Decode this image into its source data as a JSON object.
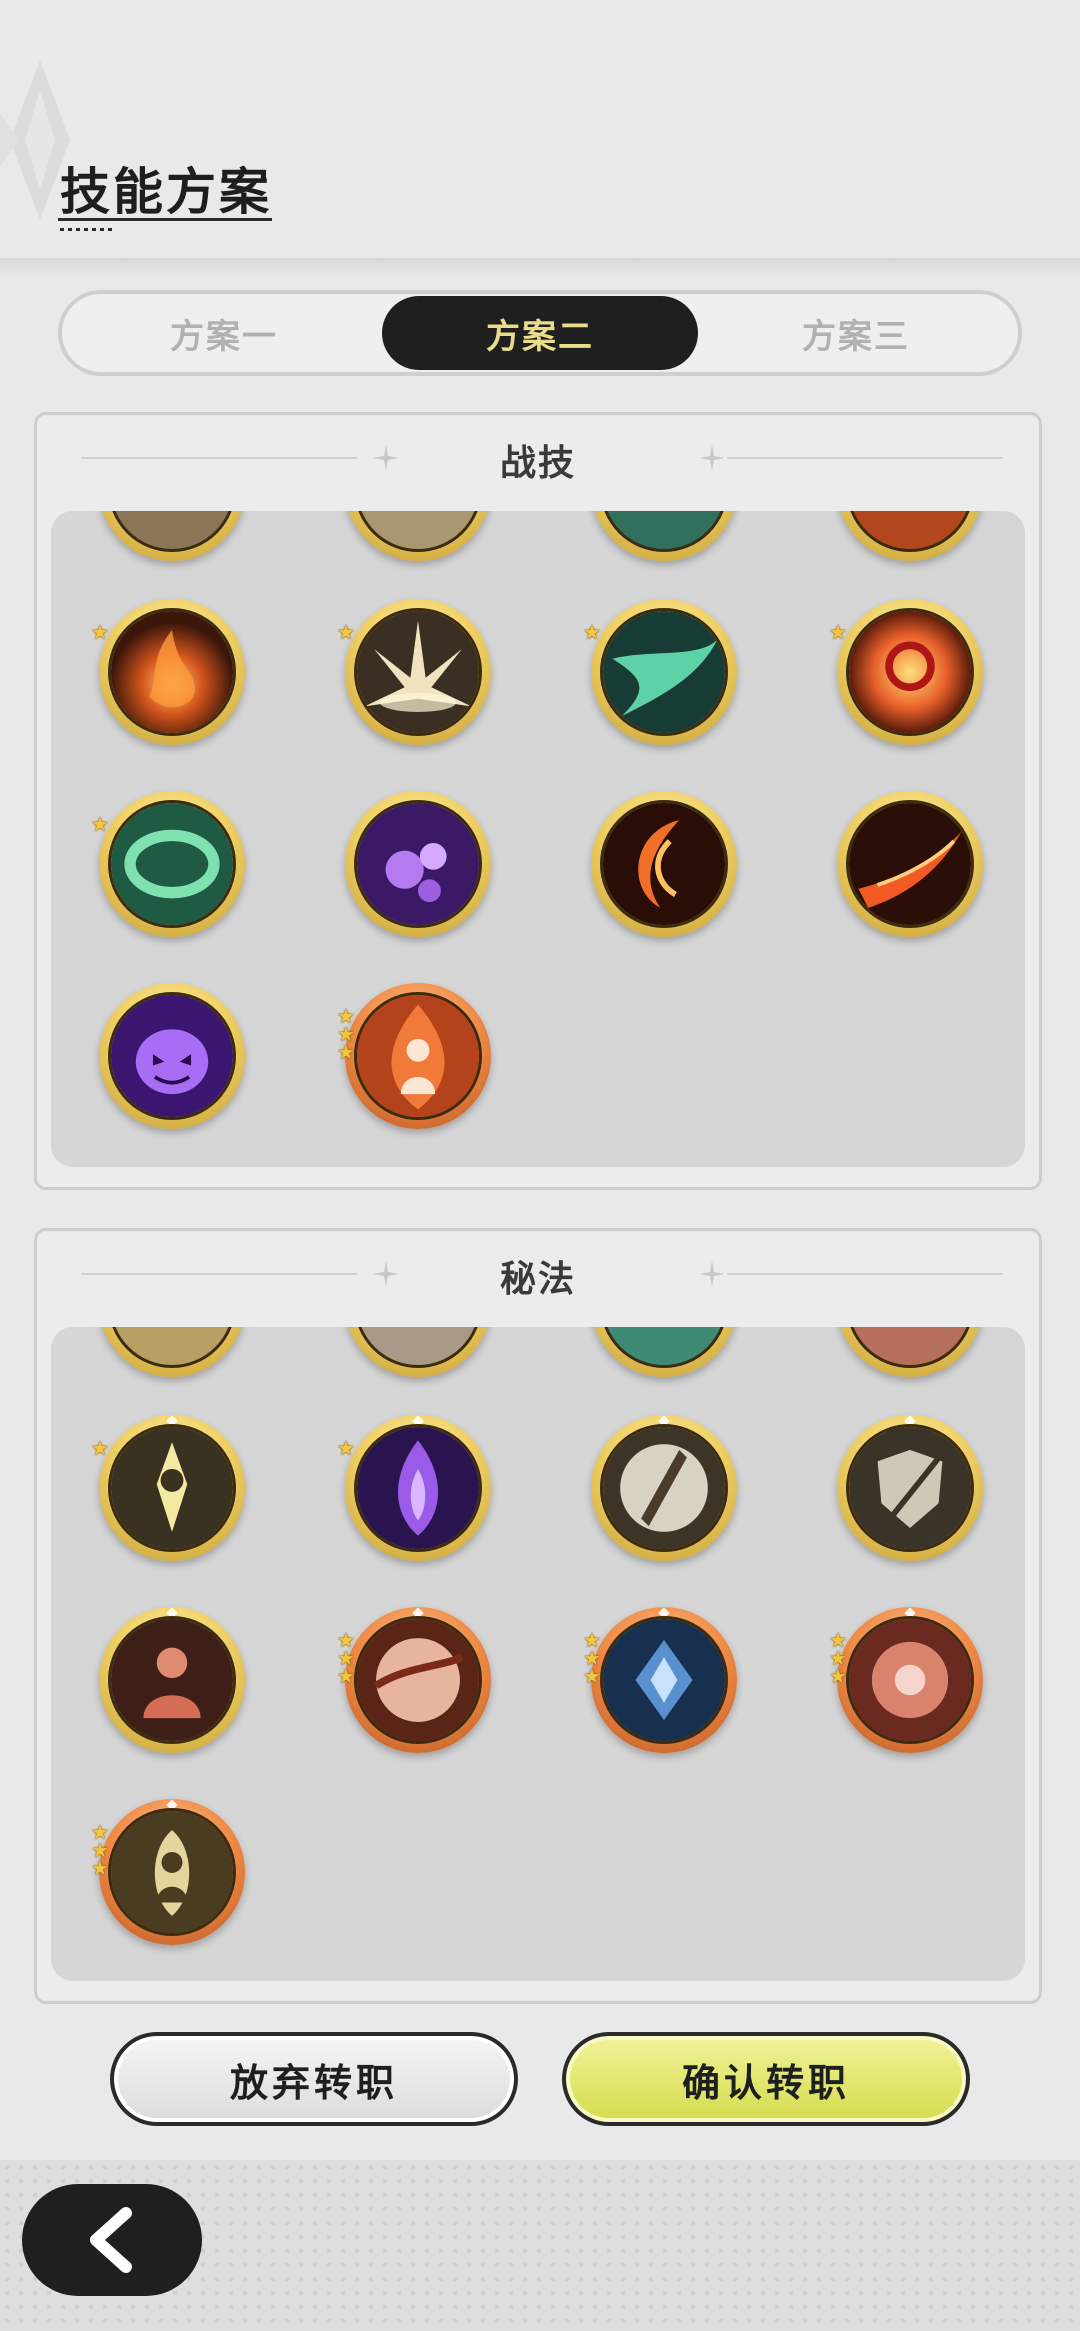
{
  "header": {
    "title": "技能方案"
  },
  "tabs": [
    {
      "label": "方案一",
      "active": false
    },
    {
      "label": "方案二",
      "active": true
    },
    {
      "label": "方案三",
      "active": false
    }
  ],
  "combat_panel": {
    "title": "战技",
    "icons": [
      "fire-swirl-icon",
      "light-burst-icon",
      "wind-slash-icon",
      "fire-seal-icon",
      "jade-ring-icon",
      "rose-purple-icon",
      "fire-crescent-icon",
      "fire-streak-icon",
      "shadow-spirit-icon",
      "flame-figure-icon"
    ]
  },
  "arcane_panel": {
    "title": "秘法",
    "icons": [
      "golden-aura-icon",
      "violet-flame-icon",
      "light-blade-icon",
      "shield-strike-icon",
      "armor-bust-icon",
      "crimson-cut-icon",
      "frost-crest-icon",
      "blossom-icon",
      "guardian-figure-icon"
    ]
  },
  "actions": {
    "cancel_label": "放弃转职",
    "confirm_label": "确认转职"
  },
  "colors": {
    "accent_active_tab_text": "#e9dc8a",
    "confirm_button": "#dfe46a",
    "background": "#e9e9e9"
  }
}
